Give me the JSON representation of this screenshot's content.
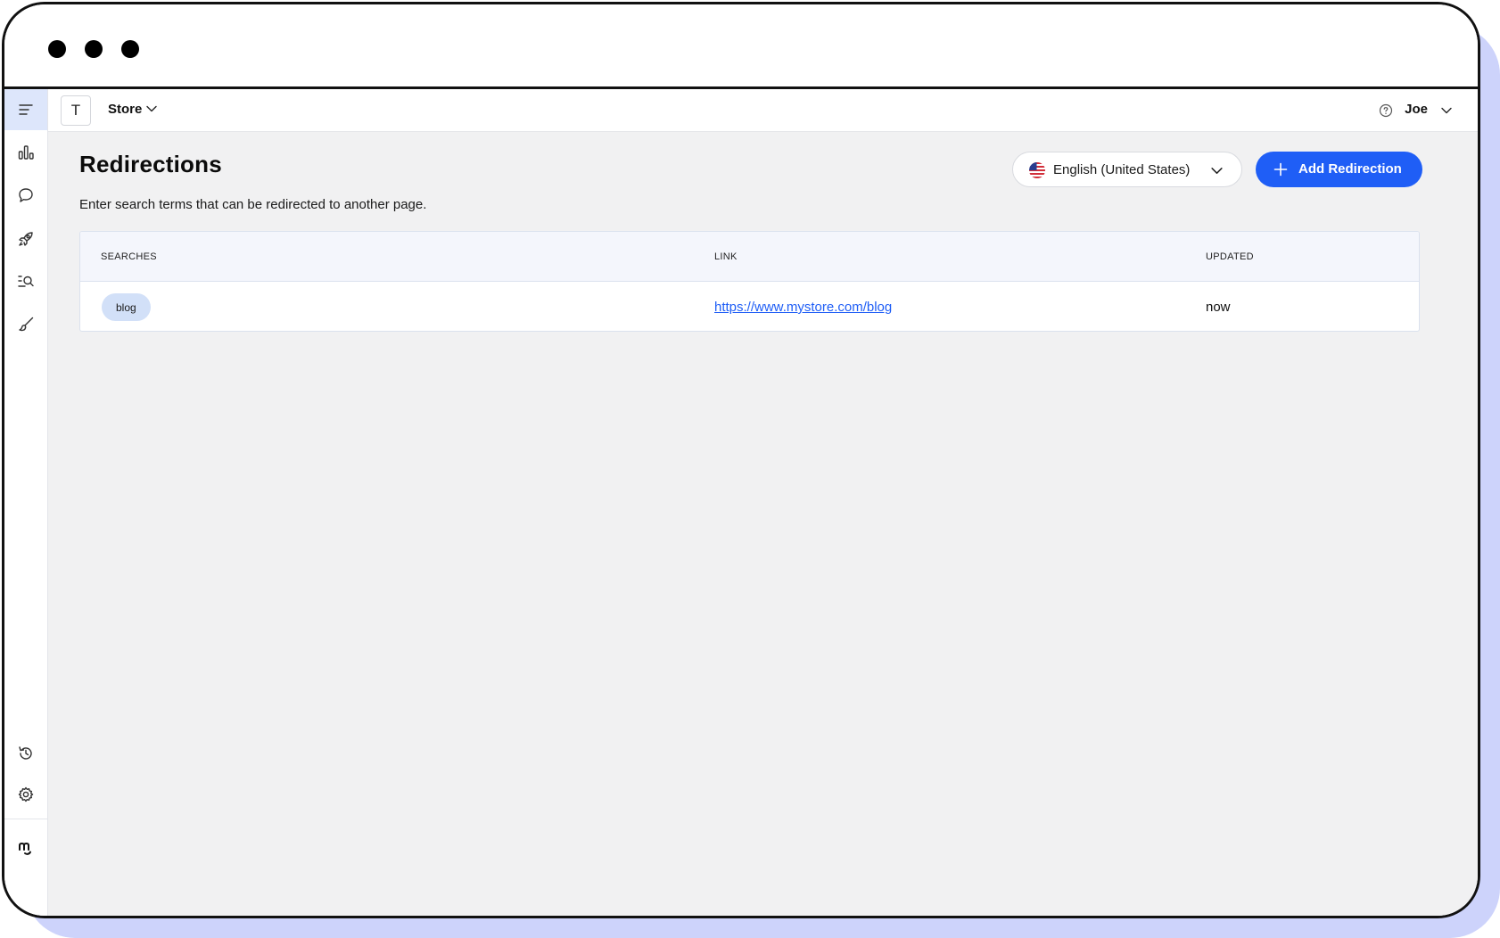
{
  "topbar": {
    "store_initial": "T",
    "store_name": "Store",
    "user_name": "Joe"
  },
  "page": {
    "title": "Redirections",
    "description": "Enter search terms that can be redirected to another page."
  },
  "language_select": {
    "selected": "English (United States)"
  },
  "actions": {
    "add_label": "Add Redirection"
  },
  "table": {
    "columns": [
      "SEARCHES",
      "LINK",
      "UPDATED"
    ],
    "rows": [
      {
        "search": "blog",
        "link": "https://www.mystore.com/blog",
        "updated": "now"
      }
    ]
  },
  "colors": {
    "accent": "#1f5ef6",
    "frame_shadow": "#cdd3fb",
    "content_bg": "#f1f1f2",
    "chip_bg": "#d2e0f8"
  },
  "icons": {
    "sidebar": [
      "menu-icon",
      "chart-icon",
      "chat-icon",
      "rocket-icon",
      "search-list-icon",
      "brush-icon",
      "history-icon",
      "gear-icon",
      "brand-logo-icon"
    ]
  }
}
